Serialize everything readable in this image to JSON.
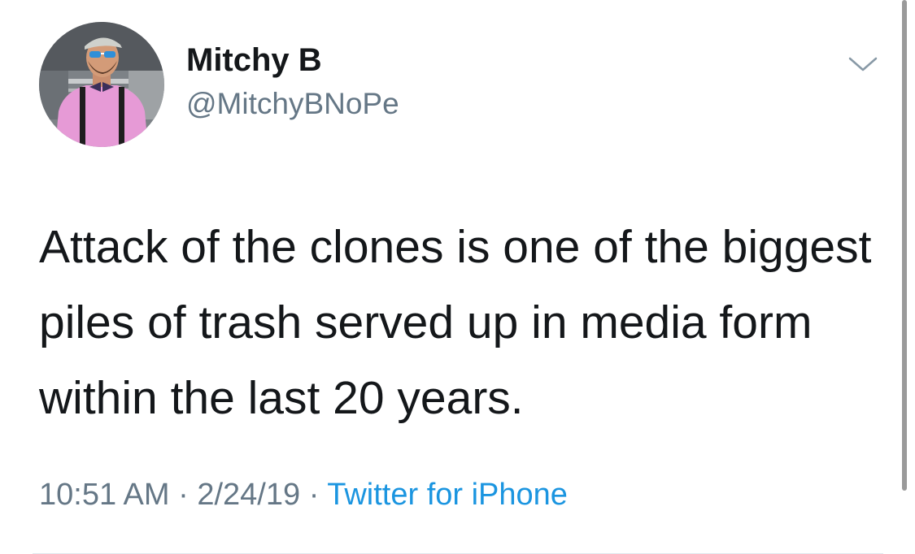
{
  "user": {
    "display_name": "Mitchy B",
    "handle": "@MitchyBNoPe"
  },
  "tweet": {
    "text": "Attack of the clones is one of the biggest piles of trash served up in media form within the last 20 years.",
    "time": "10:51 AM",
    "separator": "·",
    "date": "2/24/19",
    "source": "Twitter for iPhone"
  },
  "icons": {
    "menu": "chevron-down-icon"
  },
  "colors": {
    "text": "#14171a",
    "secondary": "#657786",
    "link": "#1b95e0",
    "avatar_shirt": "#e69ad6"
  }
}
